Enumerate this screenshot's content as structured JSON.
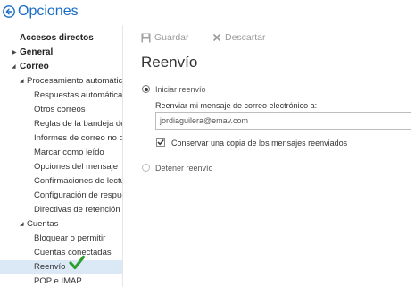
{
  "header": {
    "title": "Opciones"
  },
  "sidebar": {
    "shortcuts": "Accesos directos",
    "general": "General",
    "mail": "Correo",
    "auto_processing": "Procesamiento automático",
    "processing_items": [
      "Respuestas automáticas",
      "Otros correos",
      "Reglas de la bandeja de entrada",
      "Informes de correo no deseado",
      "Marcar como leído",
      "Opciones del mensaje",
      "Confirmaciones de lectura",
      "Configuración de respuesta",
      "Directivas de retención"
    ],
    "accounts": "Cuentas",
    "account_items": [
      "Bloquear o permitir",
      "Cuentas conectadas",
      "Reenvío",
      "POP e IMAP"
    ],
    "selected": "Reenvío"
  },
  "toolbar": {
    "save": "Guardar",
    "discard": "Descartar"
  },
  "main": {
    "title": "Reenvío",
    "start_forwarding": "Iniciar reenvío",
    "forward_to_label": "Reenviar mi mensaje de correo electrónico a:",
    "forward_address": "jordiaguilera@emav.com",
    "keep_copy": "Conservar una copia de los mensajes reenviados",
    "stop_forwarding": "Detener reenvío",
    "keep_copy_checked": true,
    "forwarding_enabled": true
  },
  "colors": {
    "accent": "#1a6dc4",
    "selected_bg": "#dbe8f6",
    "check_green": "#2e9e2e"
  },
  "icons": [
    "back-arrow-icon",
    "save-icon",
    "close-icon",
    "checkmark-icon"
  ]
}
